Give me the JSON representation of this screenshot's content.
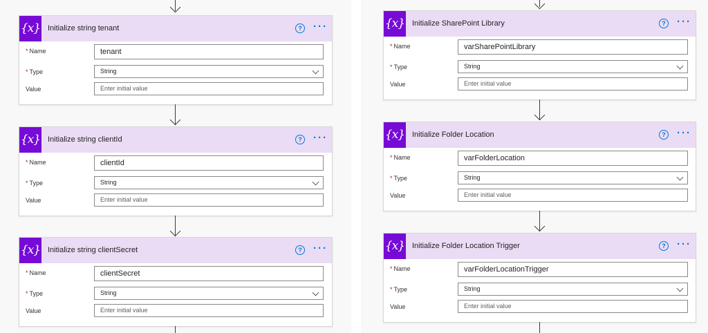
{
  "icon_glyph": "{x}",
  "field_labels": {
    "name": "Name",
    "type": "Type",
    "value": "Value",
    "required_marker": "*"
  },
  "help_glyph": "?",
  "more_glyph": "···",
  "colors": {
    "header_bg": "#eadcf5",
    "icon_bg": "#770bd6",
    "accent": "#0078d4",
    "required": "#a4262c"
  },
  "left_cards": [
    {
      "title": "Initialize string tenant",
      "name_value": "tenant",
      "type_value": "String",
      "value_placeholder": "Enter initial value"
    },
    {
      "title": "Initialize string clientId",
      "name_value": "clientId",
      "type_value": "String",
      "value_placeholder": "Enter initial value"
    },
    {
      "title": "Initialize string clientSecret",
      "name_value": "clientSecret",
      "type_value": "String",
      "value_placeholder": "Enter initial value"
    }
  ],
  "right_cards": [
    {
      "title": "Initialize SharePoint Library",
      "name_value": "varSharePointLibrary",
      "type_value": "String",
      "value_placeholder": "Enter initial value"
    },
    {
      "title": "Initialize Folder Location",
      "name_value": "varFolderLocation",
      "type_value": "String",
      "value_placeholder": "Enter initial value"
    },
    {
      "title": "Initialize Folder Location Trigger",
      "name_value": "varFolderLocationTrigger",
      "type_value": "String",
      "value_placeholder": "Enter initial value"
    }
  ]
}
